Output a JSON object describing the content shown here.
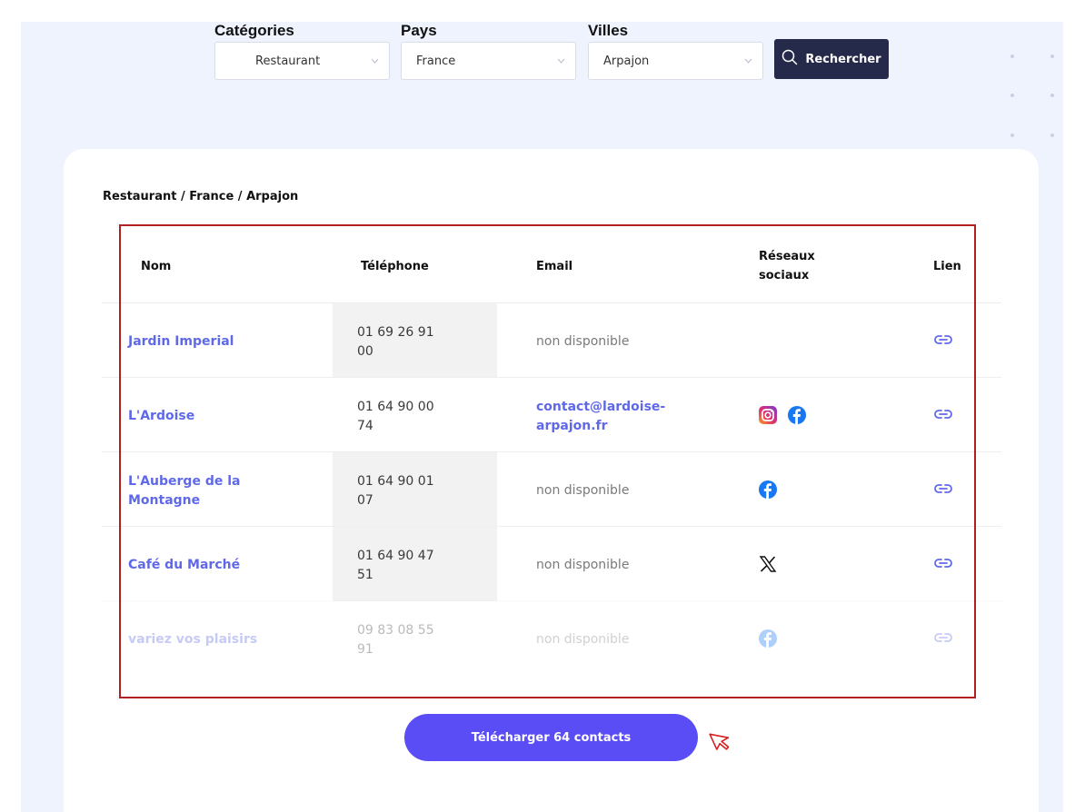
{
  "filters": {
    "categories": {
      "label": "Catégories",
      "value": "Restaurant"
    },
    "country": {
      "label": "Pays",
      "value": "France"
    },
    "city": {
      "label": "Villes",
      "value": "Arpajon"
    },
    "search_label": "Rechercher"
  },
  "breadcrumb": "Restaurant / France / Arpajon",
  "table": {
    "headers": {
      "name": "Nom",
      "phone": "Téléphone",
      "email": "Email",
      "social_line1": "Réseaux",
      "social_line2": "sociaux",
      "link": "Lien"
    },
    "rows": [
      {
        "name": "Jardin Imperial",
        "phone_l1": "01 69 26 91",
        "phone_l2": "00",
        "email": "non disponible",
        "socials": []
      },
      {
        "name": "L'Ardoise",
        "phone_l1": "01 64 90 00",
        "phone_l2": "74",
        "email_l1": "contact@lardoise-",
        "email_l2": "arpajon.fr",
        "socials": [
          "instagram-icon",
          "facebook-icon"
        ]
      },
      {
        "name_l1": "L'Auberge de la",
        "name_l2": "Montagne",
        "phone_l1": "01 64 90 01",
        "phone_l2": "07",
        "email": "non disponible",
        "socials": [
          "facebook-icon"
        ]
      },
      {
        "name": "Café du Marché",
        "phone_l1": "01 64 90 47",
        "phone_l2": "51",
        "email": "non disponible",
        "socials": [
          "x-icon"
        ]
      },
      {
        "name": "variez vos plaisirs",
        "phone_l1": "09 83 08 55",
        "phone_l2": "91",
        "email": "non disponible",
        "socials": [
          "facebook-icon"
        ]
      }
    ]
  },
  "download_label": "Télécharger 64 contacts",
  "colors": {
    "accent": "#5a4df5",
    "link": "#5f69e8",
    "dark_button": "#25294a",
    "highlight_border": "#b21f1f",
    "background": "#eef3fe"
  }
}
